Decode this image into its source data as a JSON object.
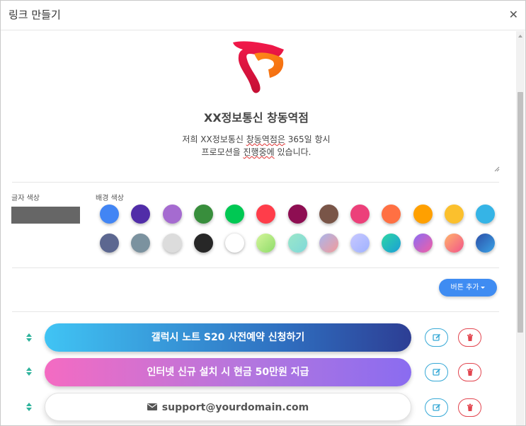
{
  "window": {
    "title": "링크 만들기",
    "close_icon": "close-icon"
  },
  "profile": {
    "logo_icon": "t-logo-icon",
    "name": "XX정보통신 창동역점",
    "description_line1_prefix": "저희 XX정보통신 ",
    "description_line1_underlined": "창동역점은",
    "description_line1_suffix": " 365일 항시",
    "description_line2_prefix": "프로모션을 ",
    "description_line2_underlined": "진행중에",
    "description_line2_suffix": " 있습니다."
  },
  "colors": {
    "text_color_label": "글자 색상",
    "text_color_value": "#666666",
    "background_color_label": "배경 색상",
    "swatches": [
      "#4285f4",
      "#512da8",
      "#a56bd0",
      "#388e3c",
      "#00c853",
      "#ff3d4a",
      "#8e0e52",
      "#795548",
      "#ec407a",
      "#ff7043",
      "#ffa000",
      "#fbc02d",
      "#35b4e6",
      "#5c6790",
      "#7b929f",
      "#dcdcdc",
      "#272727",
      "#ffffff",
      "grad-lime",
      "grad-mint",
      "grad-lavender-coral",
      "grad-periwinkle",
      "grad-teal-blue",
      "grad-purple-pink",
      "grad-orange-pink",
      "grad-navy-blue"
    ]
  },
  "actions": {
    "add_button_label": "버튼 추가"
  },
  "links": [
    {
      "label": "갤럭시 노트 S20 사전예약 신청하기",
      "style": "blue-gradient"
    },
    {
      "label": "인터넷 신규 설치 시 현금 50만원 지급",
      "style": "pink-purple-gradient"
    },
    {
      "label": "support@yourdomain.com",
      "style": "white",
      "icon": "envelope-icon"
    }
  ],
  "row_icons": {
    "drag": "drag-handle-icon",
    "edit": "edit-icon",
    "delete": "trash-icon"
  }
}
